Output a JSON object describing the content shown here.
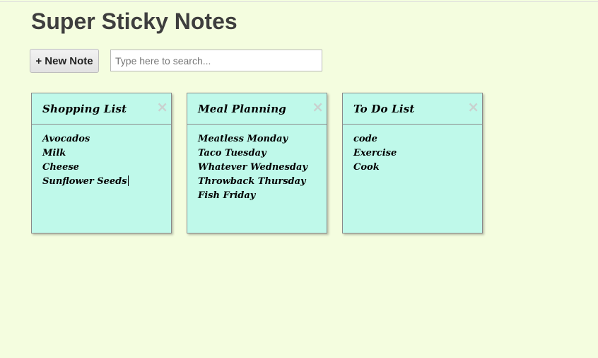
{
  "app": {
    "title": "Super Sticky Notes"
  },
  "toolbar": {
    "new_note_label": "+ New Note",
    "search_placeholder": "Type here to search...",
    "search_value": ""
  },
  "notes": [
    {
      "title": "Shopping List",
      "close_label": "×",
      "lines": [
        "Avocados",
        "Milk",
        "Cheese",
        "Sunflower Seeds"
      ],
      "editing": true
    },
    {
      "title": "Meal Planning",
      "close_label": "×",
      "lines": [
        "Meatless Monday",
        "Taco Tuesday",
        "Whatever Wednesday",
        "Throwback Thursday",
        "Fish Friday"
      ]
    },
    {
      "title": "To Do List",
      "close_label": "×",
      "lines": [
        "code",
        "Exercise",
        "Cook"
      ]
    }
  ],
  "colors": {
    "background": "#f4fddf",
    "note_background": "#bff9ea",
    "note_border": "#8a8a8a",
    "title_text": "#3e3e3e"
  }
}
